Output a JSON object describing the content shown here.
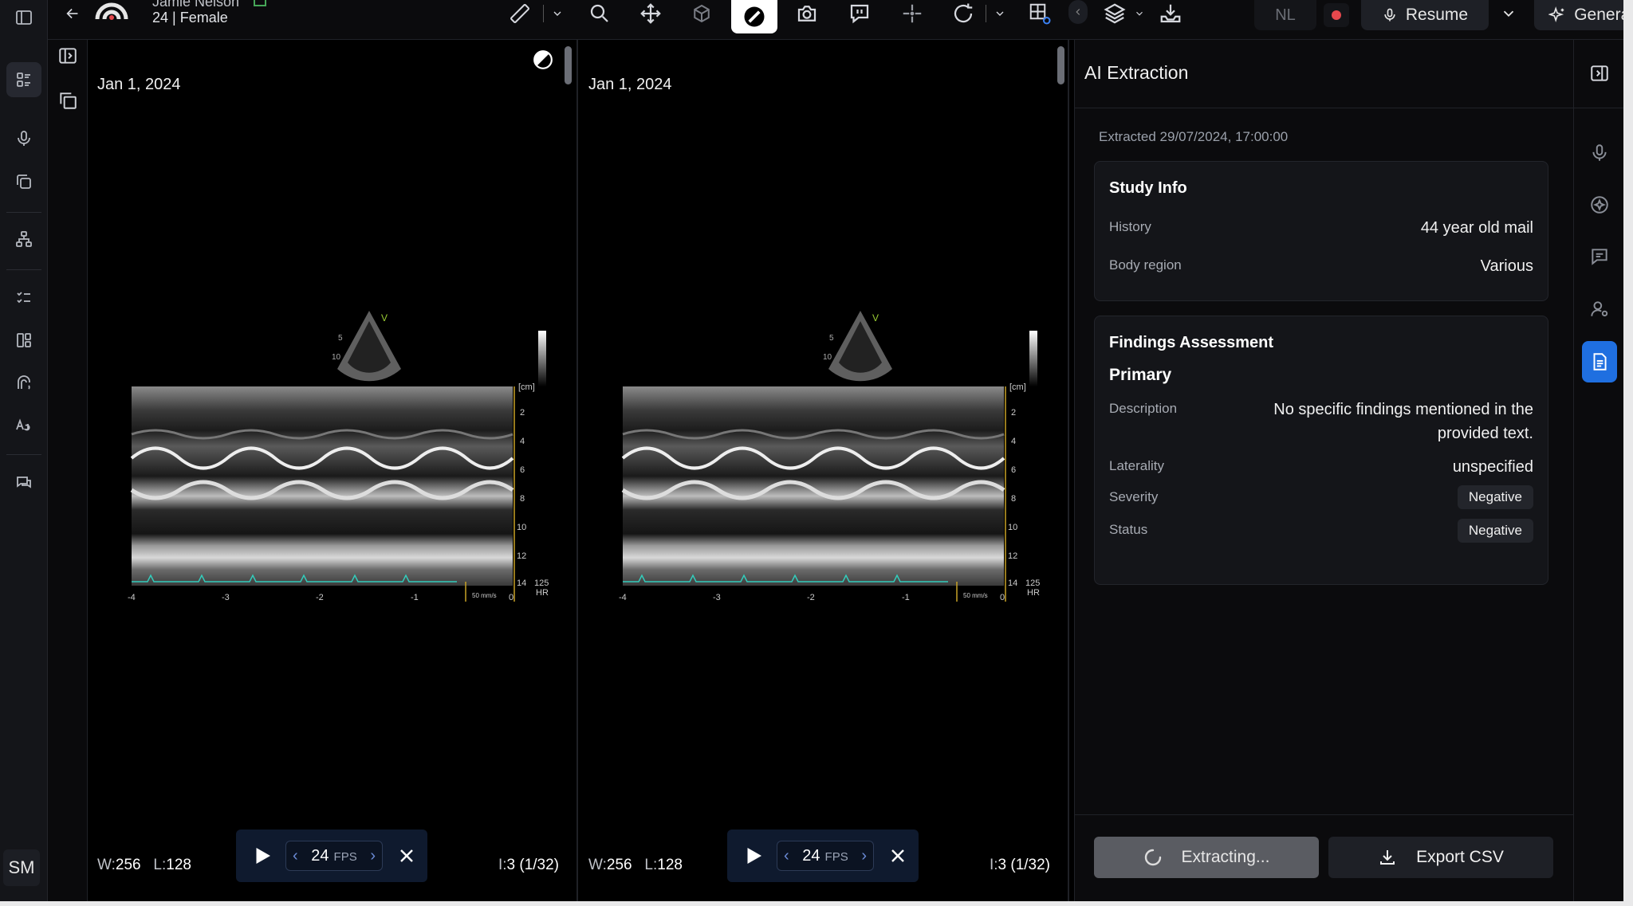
{
  "patient": {
    "name": "Jamie Nelson",
    "meta": "24 | Female"
  },
  "topbar": {
    "nl_label": "NL",
    "resume_label": "Resume",
    "generate_label": "Generate"
  },
  "user": {
    "initials": "SM"
  },
  "viewports": [
    {
      "date": "Jan 1, 2024",
      "w_label": "W:",
      "w_value": "256",
      "l_label": "L:",
      "l_value": "128",
      "i_label": "I:",
      "i_value": "3 (1/32)",
      "fps": "24",
      "fps_unit": "FPS"
    },
    {
      "date": "Jan 1, 2024",
      "w_label": "W:",
      "w_value": "256",
      "l_label": "L:",
      "l_value": "128",
      "i_label": "I:",
      "i_value": "3 (1/32)",
      "fps": "24",
      "fps_unit": "FPS"
    }
  ],
  "echo": {
    "depth_labels": [
      "[cm]",
      "2",
      "4",
      "6",
      "8",
      "10",
      "12",
      "14"
    ],
    "time_labels": [
      "-4",
      "-3",
      "-2",
      "-1",
      "0"
    ],
    "speed": "50 mm/s",
    "hr_value": "125",
    "hr_label": "HR",
    "sector_labels": [
      "5",
      "10",
      "V"
    ]
  },
  "ai": {
    "title": "AI Extraction",
    "extracted": "Extracted 29/07/2024, 17:00:00",
    "study_info": {
      "title": "Study Info",
      "history_label": "History",
      "history_value": "44 year old mail",
      "region_label": "Body region",
      "region_value": "Various"
    },
    "findings": {
      "title": "Findings Assessment",
      "primary": "Primary",
      "desc_label": "Description",
      "desc_line1": "No specific findings mentioned in the",
      "desc_line2": "provided text.",
      "laterality_label": "Laterality",
      "laterality_value": "unspecified",
      "severity_label": "Severity",
      "severity_value": "Negative",
      "status_label": "Status",
      "status_value": "Negative"
    },
    "extracting_label": "Extracting...",
    "export_label": "Export CSV"
  },
  "colors": {
    "accent": "#1f6fe0",
    "record": "#e5484d",
    "player_bg": "#0f1a2e"
  }
}
